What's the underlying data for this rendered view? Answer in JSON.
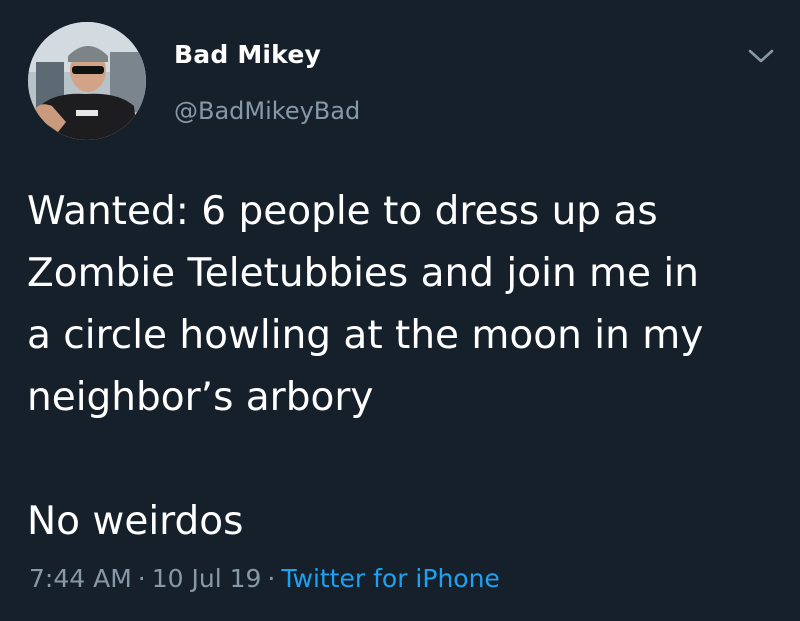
{
  "author": {
    "display_name": "Bad Mikey",
    "handle": "@BadMikeyBad",
    "avatar_icon": "user-avatar-photo"
  },
  "menu": {
    "icon": "chevron-down-icon"
  },
  "tweet": {
    "lines": [
      "Wanted: 6 people to dress up as",
      "Zombie Teletubbies and join me in",
      "a circle howling at the moon in my",
      "neighbor’s arbory"
    ],
    "closing": "No weirdos"
  },
  "meta": {
    "time": "7:44 AM",
    "separator": "·",
    "date": "10 Jul 19",
    "source": "Twitter for iPhone"
  },
  "colors": {
    "background": "#15202b",
    "text": "#ffffff",
    "secondary": "#8899a6",
    "link": "#1da1f2"
  }
}
